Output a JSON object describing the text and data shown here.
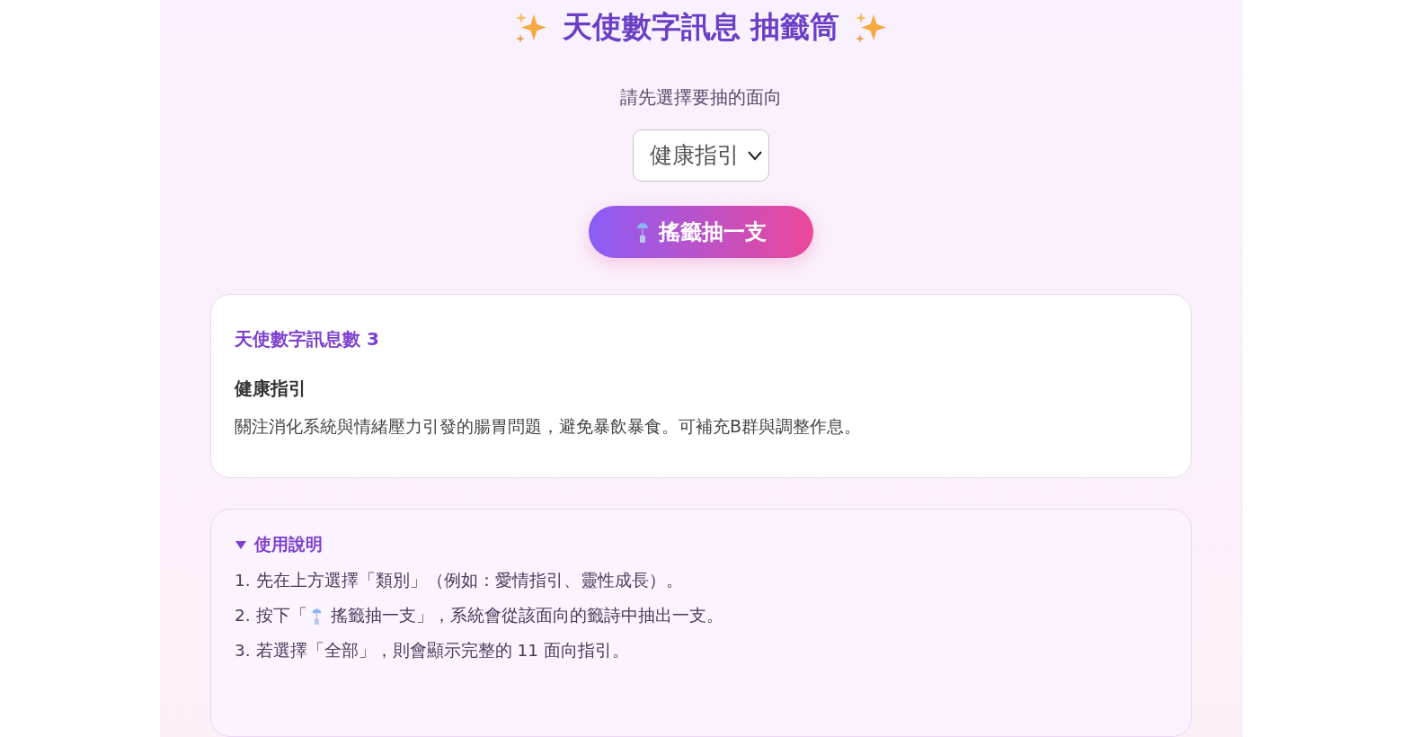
{
  "title": "天使數字訊息 抽籤筒",
  "prompt": "請先選擇要抽的面向",
  "category_select": {
    "value": "健康指引"
  },
  "draw_button": {
    "label": "搖籤抽一支"
  },
  "result": {
    "number_title": "天使數字訊息數 3",
    "heading": "健康指引",
    "message": "關注消化系統與情緒壓力引發的腸胃問題，避免暴飲暴食。可補充B群與調整作息。"
  },
  "instructions": {
    "title": "使用說明",
    "expanded": true,
    "steps": [
      {
        "kind": "text",
        "text": "1. 先在上方選擇「類別」（例如：愛情指引、靈性成長）。"
      },
      {
        "kind": "with_icon",
        "before": "2. 按下「",
        "after": "搖籤抽一支」，系統會從該面向的籤詩中抽出一支。"
      },
      {
        "kind": "text",
        "text": "3. 若選擇「全部」，則會顯示完整的 11 面向指引。"
      }
    ]
  }
}
